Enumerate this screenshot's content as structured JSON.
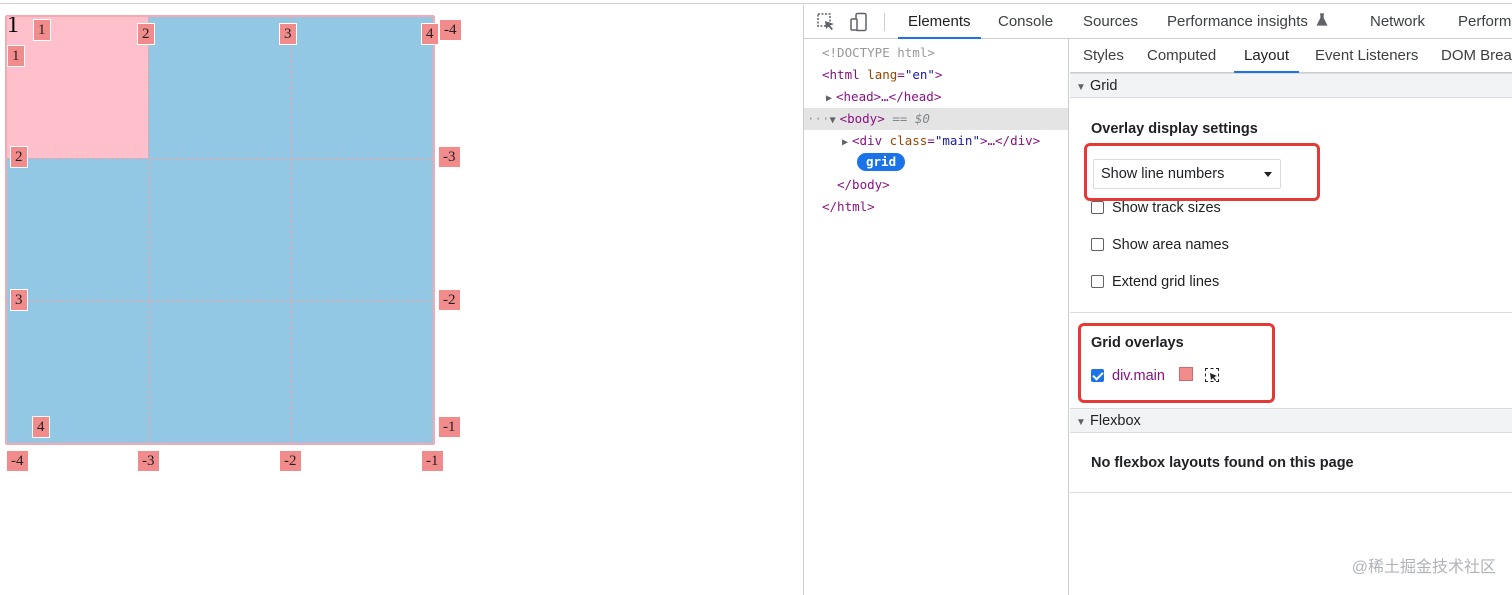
{
  "page": {
    "grid_item_text": "1",
    "line_numbers": {
      "top": [
        "1",
        "2",
        "3",
        "4"
      ],
      "top_right_negative": "-4",
      "left": [
        "1",
        "2",
        "3",
        "4"
      ],
      "right": [
        "-3",
        "-2",
        "-1"
      ],
      "bottom": [
        "-4",
        "-3",
        "-2",
        "-1"
      ]
    },
    "colors": {
      "grid_bg": "#93c8e4",
      "item_bg": "#ffc0cb",
      "line_label": "#f28b8b"
    }
  },
  "devtools": {
    "toolbar": {
      "icons": [
        "inspect-element-icon",
        "device-toolbar-icon"
      ],
      "tabs": [
        "Elements",
        "Console",
        "Sources",
        "Performance insights",
        "Network",
        "Performa"
      ],
      "active_tab": "Elements"
    },
    "elements": {
      "doctype": "<!DOCTYPE html>",
      "html_open": "<html lang=\"en\">",
      "html_open_parts": {
        "tag_start": "<html",
        "attr": "lang",
        "eq": "=",
        "val": "\"en\"",
        "tag_end": ">"
      },
      "head": "<head>…</head>",
      "body_tag": "<body>",
      "body_suffix": "== $0",
      "dots": "···",
      "div_parts": {
        "tag_start": "<div",
        "attr": "class",
        "eq": "=",
        "val": "\"main\"",
        "tag_end": ">…</div>"
      },
      "grid_badge": "grid",
      "body_close": "</body>",
      "html_close": "</html>"
    },
    "sidebar_tabs": [
      "Styles",
      "Computed",
      "Layout",
      "Event Listeners",
      "DOM Breal"
    ],
    "active_sidebar_tab": "Layout",
    "layout": {
      "grid_header": "Grid",
      "overlay_settings_title": "Overlay display settings",
      "select_value": "Show line numbers",
      "checkboxes": [
        {
          "label": "Show track sizes",
          "checked": false
        },
        {
          "label": "Show area names",
          "checked": false
        },
        {
          "label": "Extend grid lines",
          "checked": false
        }
      ],
      "grid_overlays_title": "Grid overlays",
      "overlay_item": {
        "label": "div.main",
        "checked": true,
        "color": "#f28b8b"
      },
      "flexbox_header": "Flexbox",
      "flexbox_empty": "No flexbox layouts found on this page"
    },
    "accent_color": "#1a73e8",
    "highlight_color": "#e53935"
  },
  "watermark": "@稀土掘金技术社区"
}
